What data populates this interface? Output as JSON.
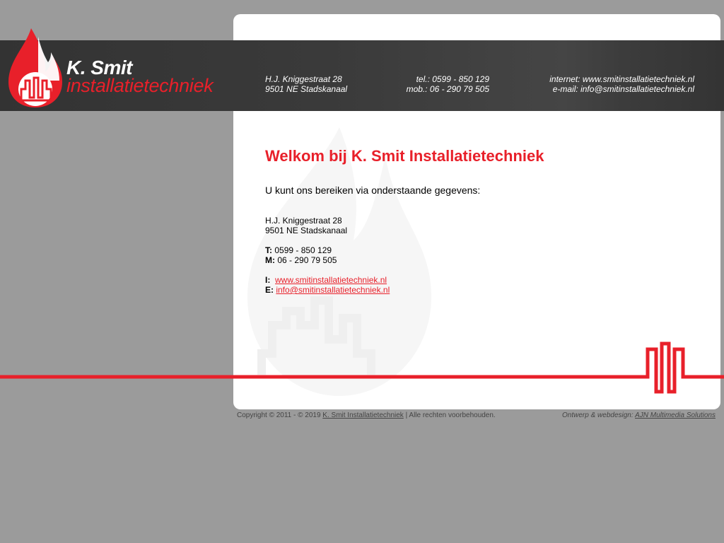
{
  "brand": {
    "name_line1": "K. Smit",
    "name_line2": "installatietechniek",
    "accent_color": "#e8202a",
    "header_color": "#3a3a3a",
    "background_color": "#9b9b9b"
  },
  "header": {
    "address_line1": "H.J. Kniggestraat 28",
    "address_line2": "9501 NE Stadskanaal",
    "tel": "tel.: 0599 - 850 129",
    "mob": "mob.: 06 - 290 79 505",
    "internet": "internet: www.smitinstallatietechniek.nl",
    "email": "e-mail: info@smitinstallatietechniek.nl"
  },
  "main": {
    "title": "Welkom bij K. Smit Installatietechniek",
    "intro": "U kunt ons bereiken via onderstaande gegevens:",
    "address_line1": "H.J. Kniggestraat 28",
    "address_line2": "9501 NE Stadskanaal",
    "tel_label": "T:",
    "tel_value": "0599 - 850 129",
    "mob_label": "M:",
    "mob_value": "06 - 290 79 505",
    "web_label": "I:",
    "web_link": "www.smitinstallatietechniek.nl",
    "email_label": "E:",
    "email_link": "info@smitinstallatietechniek.nl"
  },
  "footer": {
    "copyright_prefix": "Copyright © 2011 - © 2019",
    "copyright_link": "K. Smit Installatietechniek",
    "copyright_suffix": "| Alle rechten voorbehouden.",
    "design_prefix": "Ontwerp & webdesign:",
    "design_link": "AJN Multimedia Solutions"
  }
}
